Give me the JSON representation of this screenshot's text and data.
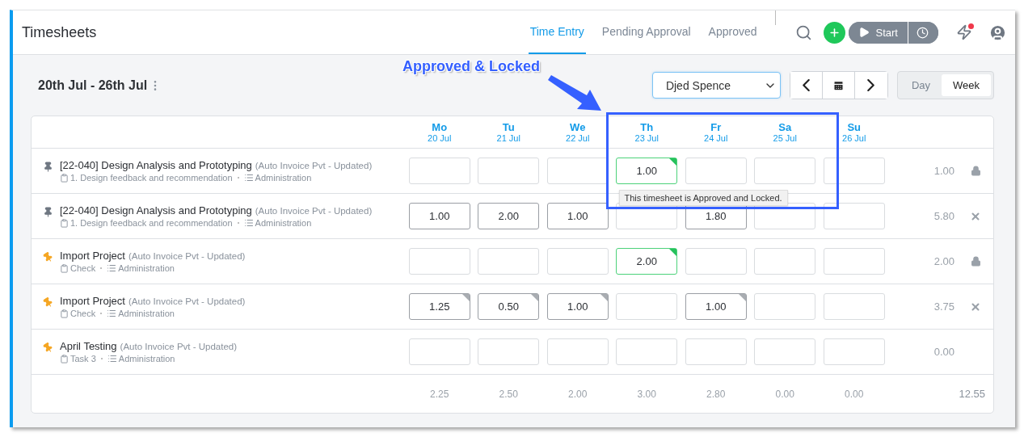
{
  "window": {
    "title": "Timesheets"
  },
  "tabs": [
    {
      "label": "Time Entry",
      "selected": true
    },
    {
      "label": "Pending Approval",
      "selected": false
    },
    {
      "label": "Approved",
      "selected": false
    }
  ],
  "header_actions": {
    "start_label": "Start",
    "notification_unread": true
  },
  "toolbar": {
    "period": "20th Jul - 26th Jul",
    "employee": "Djed Spence",
    "views": [
      {
        "label": "Day",
        "selected": false
      },
      {
        "label": "Week",
        "selected": true
      }
    ]
  },
  "days": [
    {
      "day": "Mo",
      "date": "20 Jul"
    },
    {
      "day": "Tu",
      "date": "21 Jul"
    },
    {
      "day": "We",
      "date": "22 Jul"
    },
    {
      "day": "Th",
      "date": "23 Jul"
    },
    {
      "day": "Fr",
      "date": "24 Jul"
    },
    {
      "day": "Sa",
      "date": "25 Jul"
    },
    {
      "day": "Su",
      "date": "26 Jul"
    }
  ],
  "rows": [
    {
      "project": "[22-040] Design Analysis and Prototyping",
      "client": "(Auto Invoice Pvt - Updated)",
      "task": "1. Design feedback and recommendation",
      "category": "Administration",
      "favorite": false,
      "total": "1.00",
      "locked": true,
      "removable": false,
      "cells": [
        {
          "kind": "empty"
        },
        {
          "kind": "empty"
        },
        {
          "kind": "empty"
        },
        {
          "kind": "approved",
          "value": "1.00",
          "tooltip": "This timesheet is Approved and Locked."
        },
        {
          "kind": "empty"
        },
        {
          "kind": "empty"
        },
        {
          "kind": "empty"
        }
      ]
    },
    {
      "project": "[22-040] Design Analysis and Prototyping",
      "client": "(Auto Invoice Pvt - Updated)",
      "task": "1. Design feedback and recommendation",
      "category": "Administration",
      "favorite": false,
      "total": "5.80",
      "locked": false,
      "removable": true,
      "cells": [
        {
          "kind": "saved",
          "value": "1.00"
        },
        {
          "kind": "saved",
          "value": "2.00"
        },
        {
          "kind": "saved",
          "value": "1.00"
        },
        {
          "kind": "empty"
        },
        {
          "kind": "saved",
          "value": "1.80"
        },
        {
          "kind": "empty"
        },
        {
          "kind": "empty"
        }
      ]
    },
    {
      "project": "Import Project",
      "client": "(Auto Invoice Pvt - Updated)",
      "task": "Check",
      "category": "Administration",
      "favorite": true,
      "total": "2.00",
      "locked": true,
      "removable": false,
      "cells": [
        {
          "kind": "empty"
        },
        {
          "kind": "empty"
        },
        {
          "kind": "empty"
        },
        {
          "kind": "approved",
          "value": "2.00"
        },
        {
          "kind": "empty"
        },
        {
          "kind": "empty"
        },
        {
          "kind": "empty"
        }
      ]
    },
    {
      "project": "Import Project",
      "client": "(Auto Invoice Pvt - Updated)",
      "task": "Check",
      "category": "Administration",
      "favorite": true,
      "total": "3.75",
      "locked": false,
      "removable": true,
      "cells": [
        {
          "kind": "noted",
          "value": "1.25"
        },
        {
          "kind": "noted",
          "value": "0.50"
        },
        {
          "kind": "noted",
          "value": "1.00"
        },
        {
          "kind": "empty"
        },
        {
          "kind": "noted",
          "value": "1.00"
        },
        {
          "kind": "empty"
        },
        {
          "kind": "empty"
        }
      ]
    },
    {
      "project": "April Testing",
      "client": "(Auto Invoice Pvt - Updated)",
      "task": "Task 3",
      "category": "Administration",
      "favorite": true,
      "total": "0.00",
      "locked": false,
      "removable": false,
      "cells": [
        {
          "kind": "empty"
        },
        {
          "kind": "empty"
        },
        {
          "kind": "empty"
        },
        {
          "kind": "empty"
        },
        {
          "kind": "empty"
        },
        {
          "kind": "empty"
        },
        {
          "kind": "empty"
        }
      ]
    }
  ],
  "totals": {
    "days": [
      "2.25",
      "2.50",
      "2.00",
      "3.00",
      "2.80",
      "0.00",
      "0.00"
    ],
    "grand": "12.55"
  },
  "annotation": {
    "label": "Approved & Locked"
  }
}
